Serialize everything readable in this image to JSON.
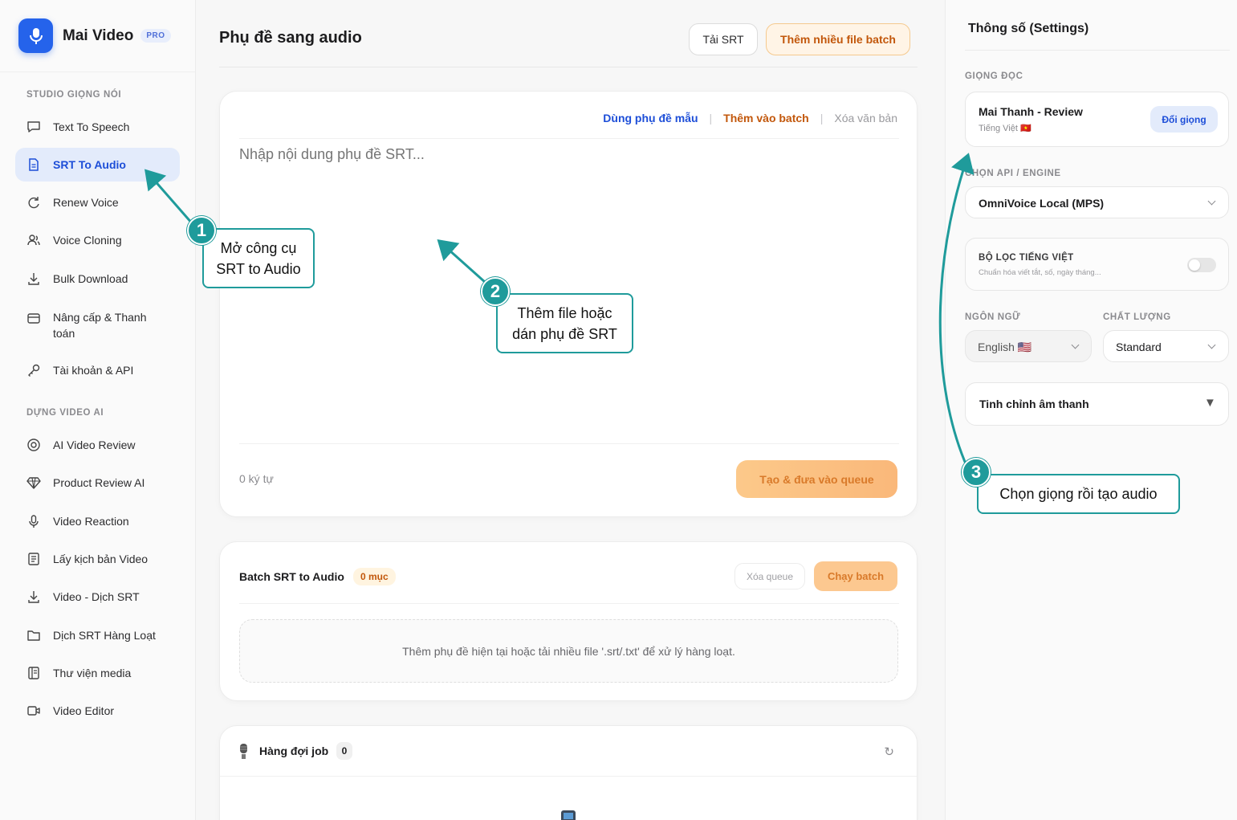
{
  "app": {
    "name": "Mai Video",
    "badge": "PRO"
  },
  "sidebar": {
    "section1": "STUDIO GIỌNG NÓI",
    "section2": "DỰNG VIDEO AI",
    "items1": [
      {
        "label": "Text To Speech",
        "icon": "chat-bubble-icon"
      },
      {
        "label": "SRT To Audio",
        "icon": "document-icon"
      },
      {
        "label": "Renew Voice",
        "icon": "refresh-icon"
      },
      {
        "label": "Voice Cloning",
        "icon": "users-icon"
      },
      {
        "label": "Bulk Download",
        "icon": "download-icon"
      },
      {
        "label": "Nâng cấp & Thanh toán",
        "icon": "card-icon"
      },
      {
        "label": "Tài khoản & API",
        "icon": "key-icon"
      }
    ],
    "items2": [
      {
        "label": "AI Video Review",
        "icon": "target-icon"
      },
      {
        "label": "Product Review AI",
        "icon": "gem-icon"
      },
      {
        "label": "Video Reaction",
        "icon": "mic-icon"
      },
      {
        "label": "Lấy kịch bản Video",
        "icon": "script-icon"
      },
      {
        "label": "Video - Dịch SRT",
        "icon": "download-icon"
      },
      {
        "label": "Dịch SRT Hàng Loạt",
        "icon": "folder-icon"
      },
      {
        "label": "Thư viện media",
        "icon": "library-icon"
      },
      {
        "label": "Video Editor",
        "icon": "video-icon"
      }
    ]
  },
  "header": {
    "title": "Phụ đề sang audio",
    "btn_upload": "Tải SRT",
    "btn_batch": "Thêm nhiều file batch"
  },
  "editor": {
    "link_sample": "Dùng phụ đề mẫu",
    "link_add_batch": "Thêm vào batch",
    "link_clear": "Xóa văn bản",
    "placeholder": "Nhập nội dung phụ đề SRT...",
    "char_count": "0 ký tự",
    "submit": "Tạo & đưa vào queue"
  },
  "batch": {
    "title": "Batch SRT to Audio",
    "count_badge": "0 mục",
    "btn_clear": "Xóa queue",
    "btn_run": "Chạy batch",
    "empty_text": "Thêm phụ đề hiện tại hoặc tải nhiều file '.srt/.txt' để xử lý hàng loạt."
  },
  "queue": {
    "title": "Hàng đợi job",
    "count": "0",
    "refresh": "↻"
  },
  "settings": {
    "title": "Thông số (Settings)",
    "voice_label": "GIỌNG ĐỌC",
    "voice_name": "Mai Thanh - Review",
    "voice_lang": "Tiếng Việt 🇻🇳",
    "voice_change": "Đổi giọng",
    "engine_label": "CHỌN API / ENGINE",
    "engine_value": "OmniVoice Local (MPS)",
    "filter_title": "BỘ LỌC TIẾNG VIỆT",
    "filter_desc": "Chuẩn hóa viết tắt, số, ngày tháng...",
    "lang_label": "NGÔN NGỮ",
    "lang_value": "English 🇺🇸",
    "quality_label": "CHẤT LƯỢNG",
    "quality_value": "Standard",
    "tune_label": "Tinh chỉnh âm thanh",
    "tune_arrow": "▼"
  },
  "annotations": {
    "step1_num": "1",
    "step1_line1": "Mở công cụ",
    "step1_line2": "SRT to Audio",
    "step2_num": "2",
    "step2_line1": "Thêm file hoặc",
    "step2_line2": "dán phụ đề SRT",
    "step3_num": "3",
    "step3_text": "Chọn giọng rồi tạo audio"
  },
  "colors": {
    "accent": "#2563eb",
    "orange": "#c2570b",
    "teal": "#1f9b9b"
  }
}
